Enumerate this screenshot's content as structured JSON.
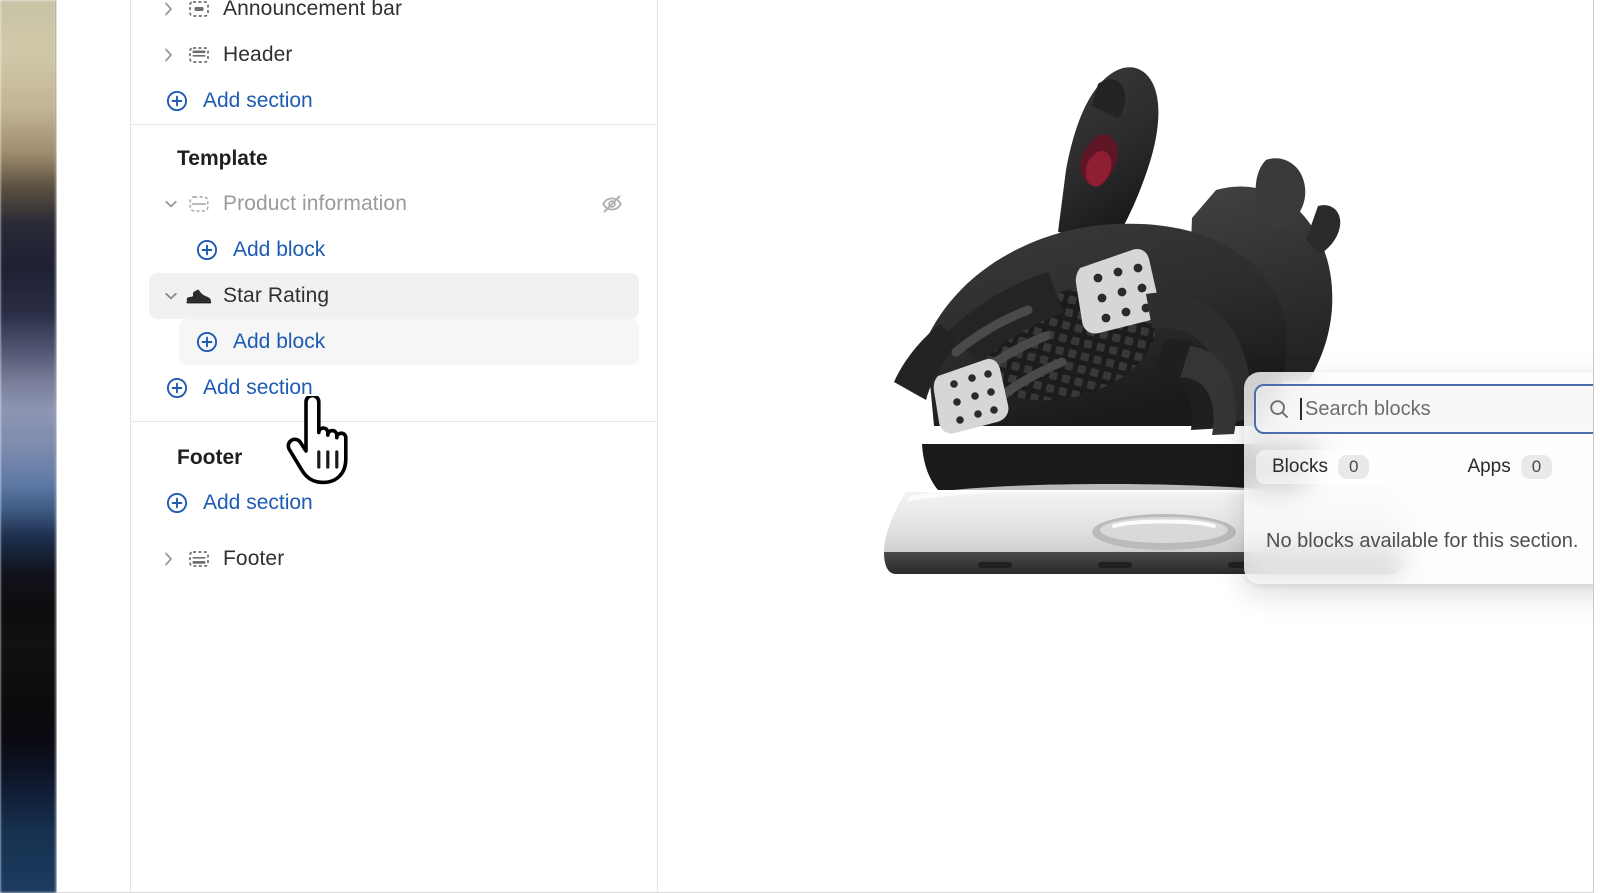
{
  "sidebar": {
    "groups": [
      {
        "name": "sections-group",
        "title": null,
        "rows": [
          {
            "type": "tree",
            "label": "Announcement bar",
            "icon": "announcement-bar-icon",
            "expanded": false,
            "muted": false,
            "clipped_top": true
          },
          {
            "type": "tree",
            "label": "Header",
            "icon": "header-icon",
            "expanded": false,
            "muted": false
          },
          {
            "type": "add",
            "label": "Add section",
            "icon": "plus-circle-icon",
            "indent": 0
          }
        ]
      },
      {
        "name": "template-group",
        "title": "Template",
        "rows": [
          {
            "type": "tree",
            "label": "Product information",
            "icon": "product-information-icon",
            "expanded": true,
            "muted": true,
            "trailing_icon": "eye-off-icon"
          },
          {
            "type": "add",
            "label": "Add block",
            "icon": "plus-circle-icon",
            "indent": 1
          },
          {
            "type": "tree",
            "label": "Star Rating",
            "icon": "sneaker-icon",
            "expanded": true,
            "muted": false,
            "selected": true
          },
          {
            "type": "add",
            "label": "Add block",
            "icon": "plus-circle-icon",
            "indent": 1,
            "highlighted": true
          },
          {
            "type": "add",
            "label": "Add section",
            "icon": "plus-circle-icon",
            "indent": 0
          }
        ]
      },
      {
        "name": "footer-group",
        "title": "Footer",
        "rows": [
          {
            "type": "add",
            "label": "Add section",
            "icon": "plus-circle-icon",
            "indent": 0
          },
          {
            "type": "tree",
            "label": "Footer",
            "icon": "footer-icon",
            "expanded": false,
            "muted": false
          }
        ]
      }
    ]
  },
  "block_picker": {
    "search": {
      "placeholder": "Search blocks",
      "value": "",
      "icon": "search-icon",
      "focused": true
    },
    "tabs": [
      {
        "label": "Blocks",
        "count": "0",
        "active": true
      },
      {
        "label": "Apps",
        "count": "0",
        "active": false
      }
    ],
    "empty_message": "No blocks available for this section."
  },
  "canvas": {
    "preview_alt": "Black denim Air Jordan 4 sneaker product photo"
  },
  "cursor": {
    "type": "pointing-hand-cursor"
  },
  "colors": {
    "link_blue": "#1e5bb3",
    "focus_ring": "#4b6ea8",
    "text_primary": "#303030",
    "text_muted": "#9a9a9a",
    "selected_row": "#f1f1f1",
    "divider": "#e6e6e6"
  }
}
